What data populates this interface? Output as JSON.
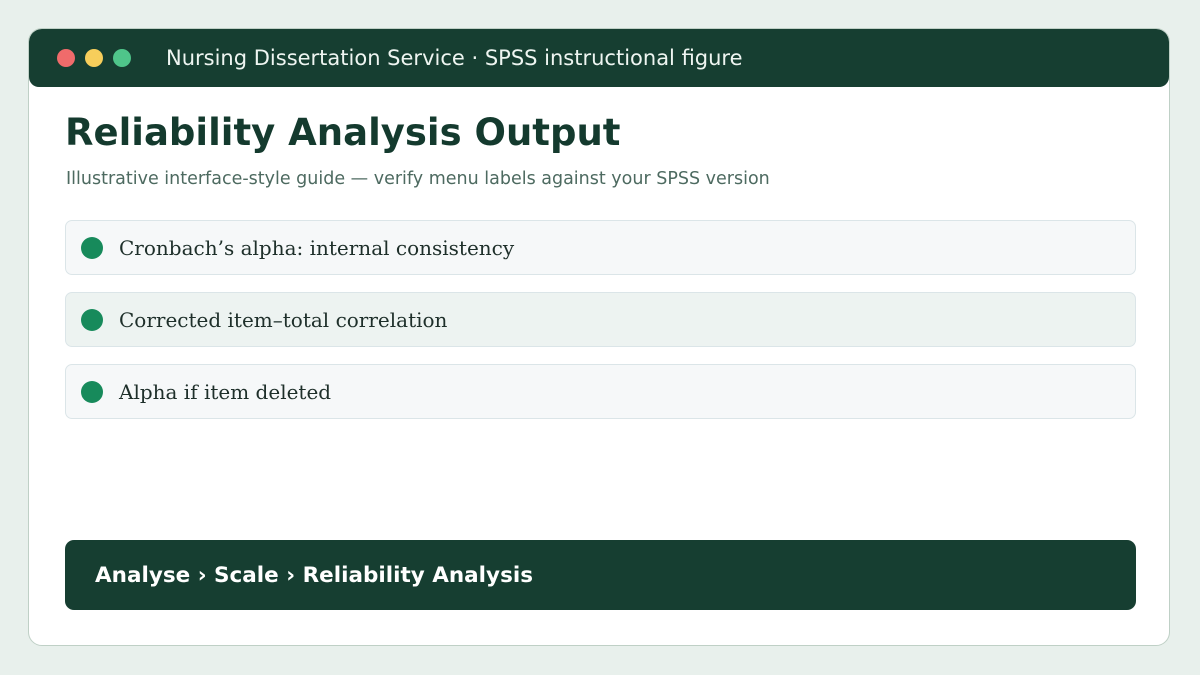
{
  "window": {
    "title": "Nursing Dissertation Service · SPSS instructional figure",
    "controls": [
      "close",
      "minimize",
      "maximize"
    ]
  },
  "page": {
    "title": "Reliability Analysis Output",
    "subtitle": "Illustrative interface-style guide — verify menu labels against your SPSS version"
  },
  "list": {
    "items": [
      {
        "label": "Cronbach’s alpha: internal consistency"
      },
      {
        "label": "Corrected item–total correlation"
      },
      {
        "label": "Alpha if item deleted"
      }
    ]
  },
  "menu_path": {
    "label": "Analyse › Scale › Reliability Analysis"
  },
  "colors": {
    "background": "#e8f0ec",
    "titlebar": "#163e31",
    "accent": "#178a5b",
    "close_dot": "#f06b6b",
    "minimize_dot": "#f7ce5b",
    "maximize_dot": "#4fc58a"
  }
}
